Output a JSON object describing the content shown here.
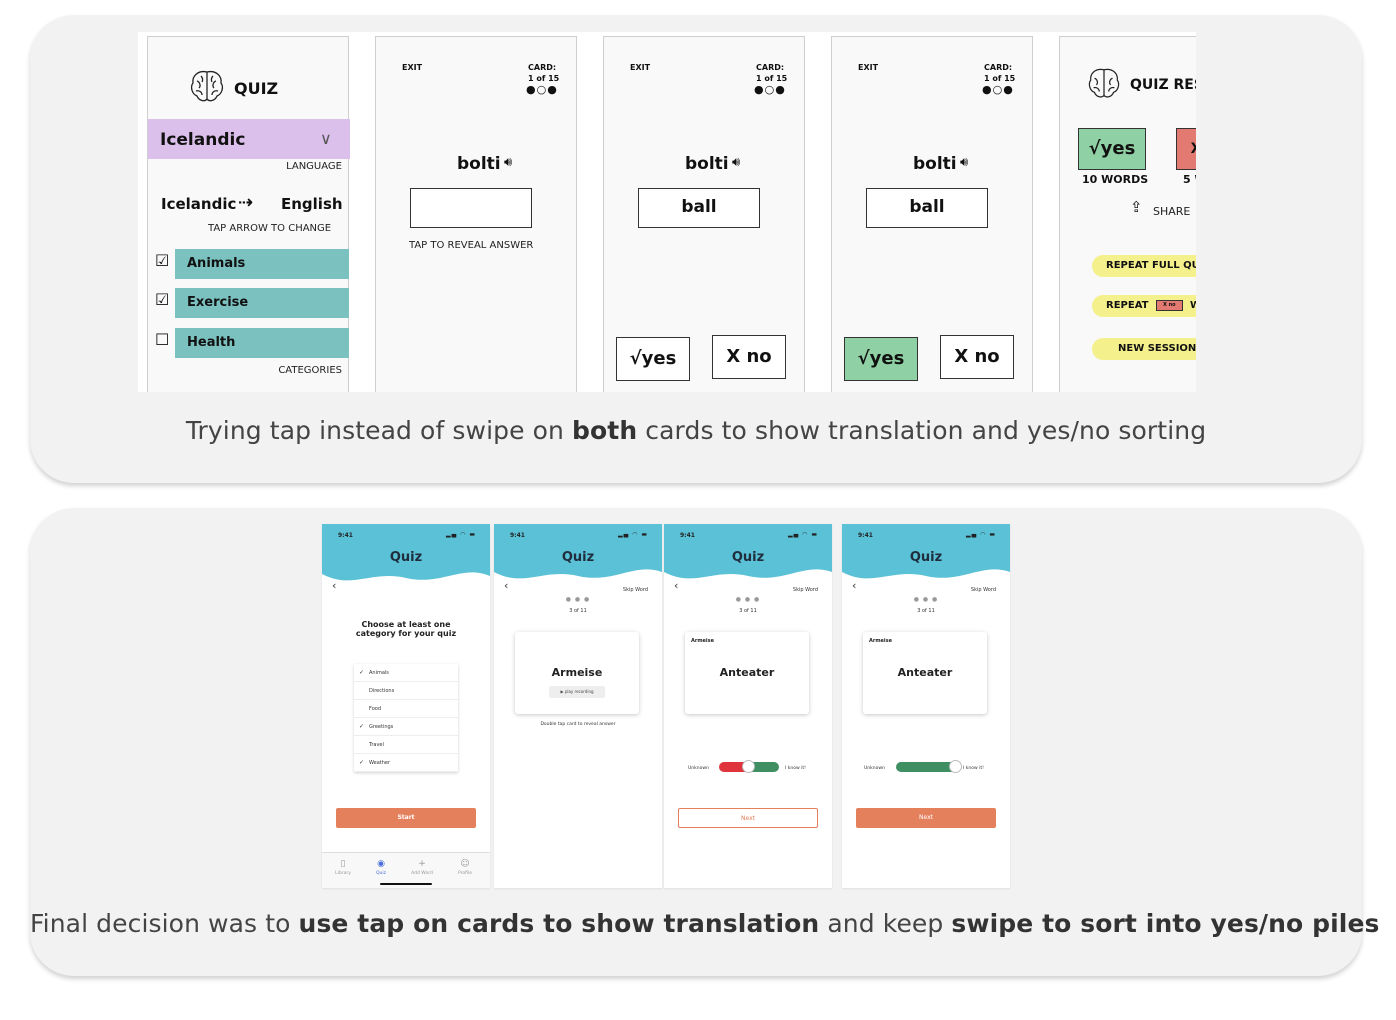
{
  "panel_top": {
    "caption_pre": "Trying tap instead of swipe on ",
    "caption_bold": "both",
    "caption_post": " cards to show translation and yes/no sorting",
    "sketch_setup": {
      "title": "QUIZ",
      "language": "Icelandic",
      "language_label": "LANGUAGE",
      "from": "Icelandic",
      "to": "English",
      "direction_hint": "TAP ARROW TO CHANGE",
      "categories": [
        {
          "label": "Animals",
          "checked": true
        },
        {
          "label": "Exercise",
          "checked": true
        },
        {
          "label": "Health",
          "checked": false
        }
      ],
      "categories_label": "CATEGORIES"
    },
    "sketch_cards": [
      {
        "exit": "EXIT",
        "card_label": "CARD:",
        "count": "1 of 15",
        "dots": "●○●",
        "word": "bolti",
        "answer": "",
        "hint": "TAP TO REVEAL ANSWER"
      },
      {
        "exit": "EXIT",
        "card_label": "CARD:",
        "count": "1 of 15",
        "dots": "●○●",
        "word": "bolti",
        "answer": "ball",
        "yes": "√yes",
        "no": "X no"
      },
      {
        "exit": "EXIT",
        "card_label": "CARD:",
        "count": "1 of 15",
        "dots": "●○●",
        "word": "bolti",
        "answer": "ball",
        "yes": "√yes",
        "no": "X no"
      }
    ],
    "sketch_results": {
      "title": "QUIZ RES",
      "yes": "√yes",
      "yes_words": "10 WORDS",
      "no": "X",
      "no_words": "5 W",
      "share": "SHARE",
      "repeat_full": "REPEAT FULL QU",
      "repeat": "REPEAT",
      "repeat_tag": "X no",
      "repeat_tail": "WO",
      "new_session": "NEW SESSION"
    }
  },
  "panel_bottom": {
    "caption_pre": "Final decision was to ",
    "caption_bold1": "use tap on cards to show translation",
    "caption_mid": " and keep ",
    "caption_bold2": "swipe to sort into yes/no piles",
    "time": "9:41",
    "app_title": "Quiz",
    "setup": {
      "heading_line1": "Choose at least one",
      "heading_line2": "category for your quiz",
      "categories": [
        {
          "label": "Animals",
          "check": "✓"
        },
        {
          "label": "Directions",
          "check": ""
        },
        {
          "label": "Food",
          "check": ""
        },
        {
          "label": "Greetings",
          "check": "✓"
        },
        {
          "label": "Travel",
          "check": ""
        },
        {
          "label": "Weather",
          "check": "✓"
        }
      ],
      "start": "Start",
      "tabs": [
        "Library",
        "Quiz",
        "Add Word",
        "Profile"
      ]
    },
    "cards": [
      {
        "skip": "Skip Word",
        "count": "3 of 11",
        "word": "Armeise",
        "sub": "",
        "play": "▶ play recording",
        "hint": "Double tap card to reveal answer"
      },
      {
        "skip": "Skip Word",
        "count": "3 of 11",
        "word": "Anteater",
        "sub": "Armeise",
        "unknown": "Unknown",
        "know": "I know it!",
        "next": "Next",
        "slider_level": 0.5
      },
      {
        "skip": "Skip Word",
        "count": "3 of 11",
        "word": "Anteater",
        "sub": "Armeise",
        "unknown": "Unknown",
        "know": "I know it!",
        "next": "Next",
        "slider_level": 1.0
      }
    ],
    "colors": {
      "header": "#5bc1d6",
      "accent": "#e5805d",
      "green": "#3f8f63",
      "red": "#e0343c"
    }
  }
}
